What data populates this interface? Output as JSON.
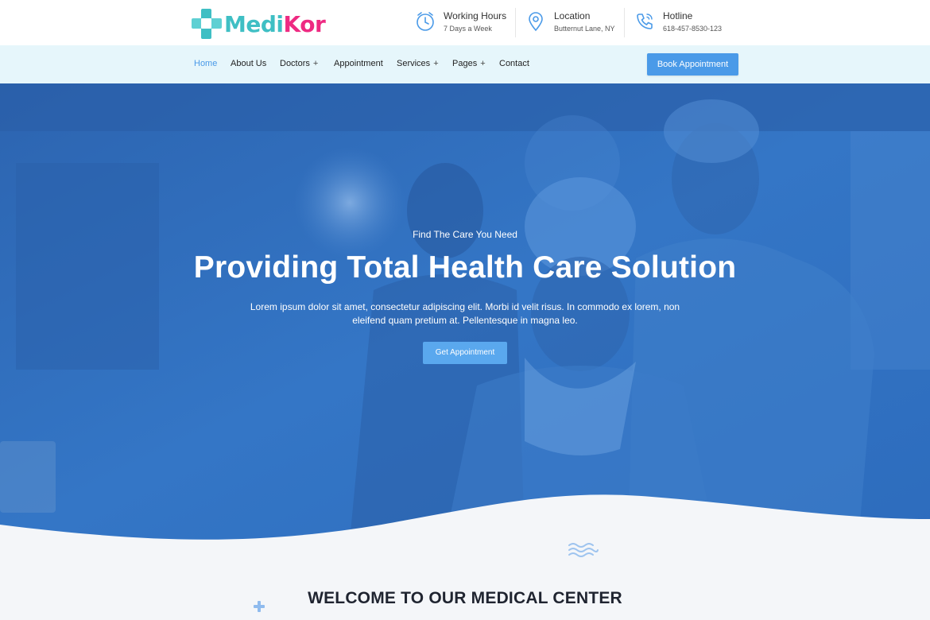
{
  "brand": {
    "name_part1": "Medi",
    "name_part2": "Kor",
    "color1": "#3fbfc4",
    "color2": "#ee2a82"
  },
  "header_info": [
    {
      "icon": "clock-icon",
      "title": "Working Hours",
      "detail": "7 Days a Week"
    },
    {
      "icon": "location-pin-icon",
      "title": "Location",
      "detail": "Butternut Lane, NY"
    },
    {
      "icon": "phone-icon",
      "title": "Hotline",
      "detail": "618-457-8530-123"
    }
  ],
  "nav": {
    "items": [
      {
        "label": "Home",
        "active": true
      },
      {
        "label": "About Us"
      },
      {
        "label": "Doctors",
        "has_submenu": true
      },
      {
        "label": "Appointment"
      },
      {
        "label": "Services",
        "has_submenu": true
      },
      {
        "label": "Pages",
        "has_submenu": true
      },
      {
        "label": "Contact"
      }
    ],
    "submenu_symbol": "+",
    "cta_label": "Book Appointment"
  },
  "hero": {
    "subtitle": "Find The Care You Need",
    "title": "Providing Total Health Care Solution",
    "text_line1": "Lorem ipsum dolor sit amet, consectetur adipiscing elit. Morbi id velit risus. In commodo ex lorem, non",
    "text_line2": "eleifend quam pretium at. Pellentesque in magna leo.",
    "button_label": "Get Appointment"
  },
  "welcome": {
    "title": "WELCOME TO OUR MEDICAL CENTER"
  },
  "colors": {
    "accent": "#4a9ae8",
    "nav_bg": "#e6f6fb",
    "hero_overlay": "#2f6fc0",
    "page_bg": "#f4f6f9"
  }
}
